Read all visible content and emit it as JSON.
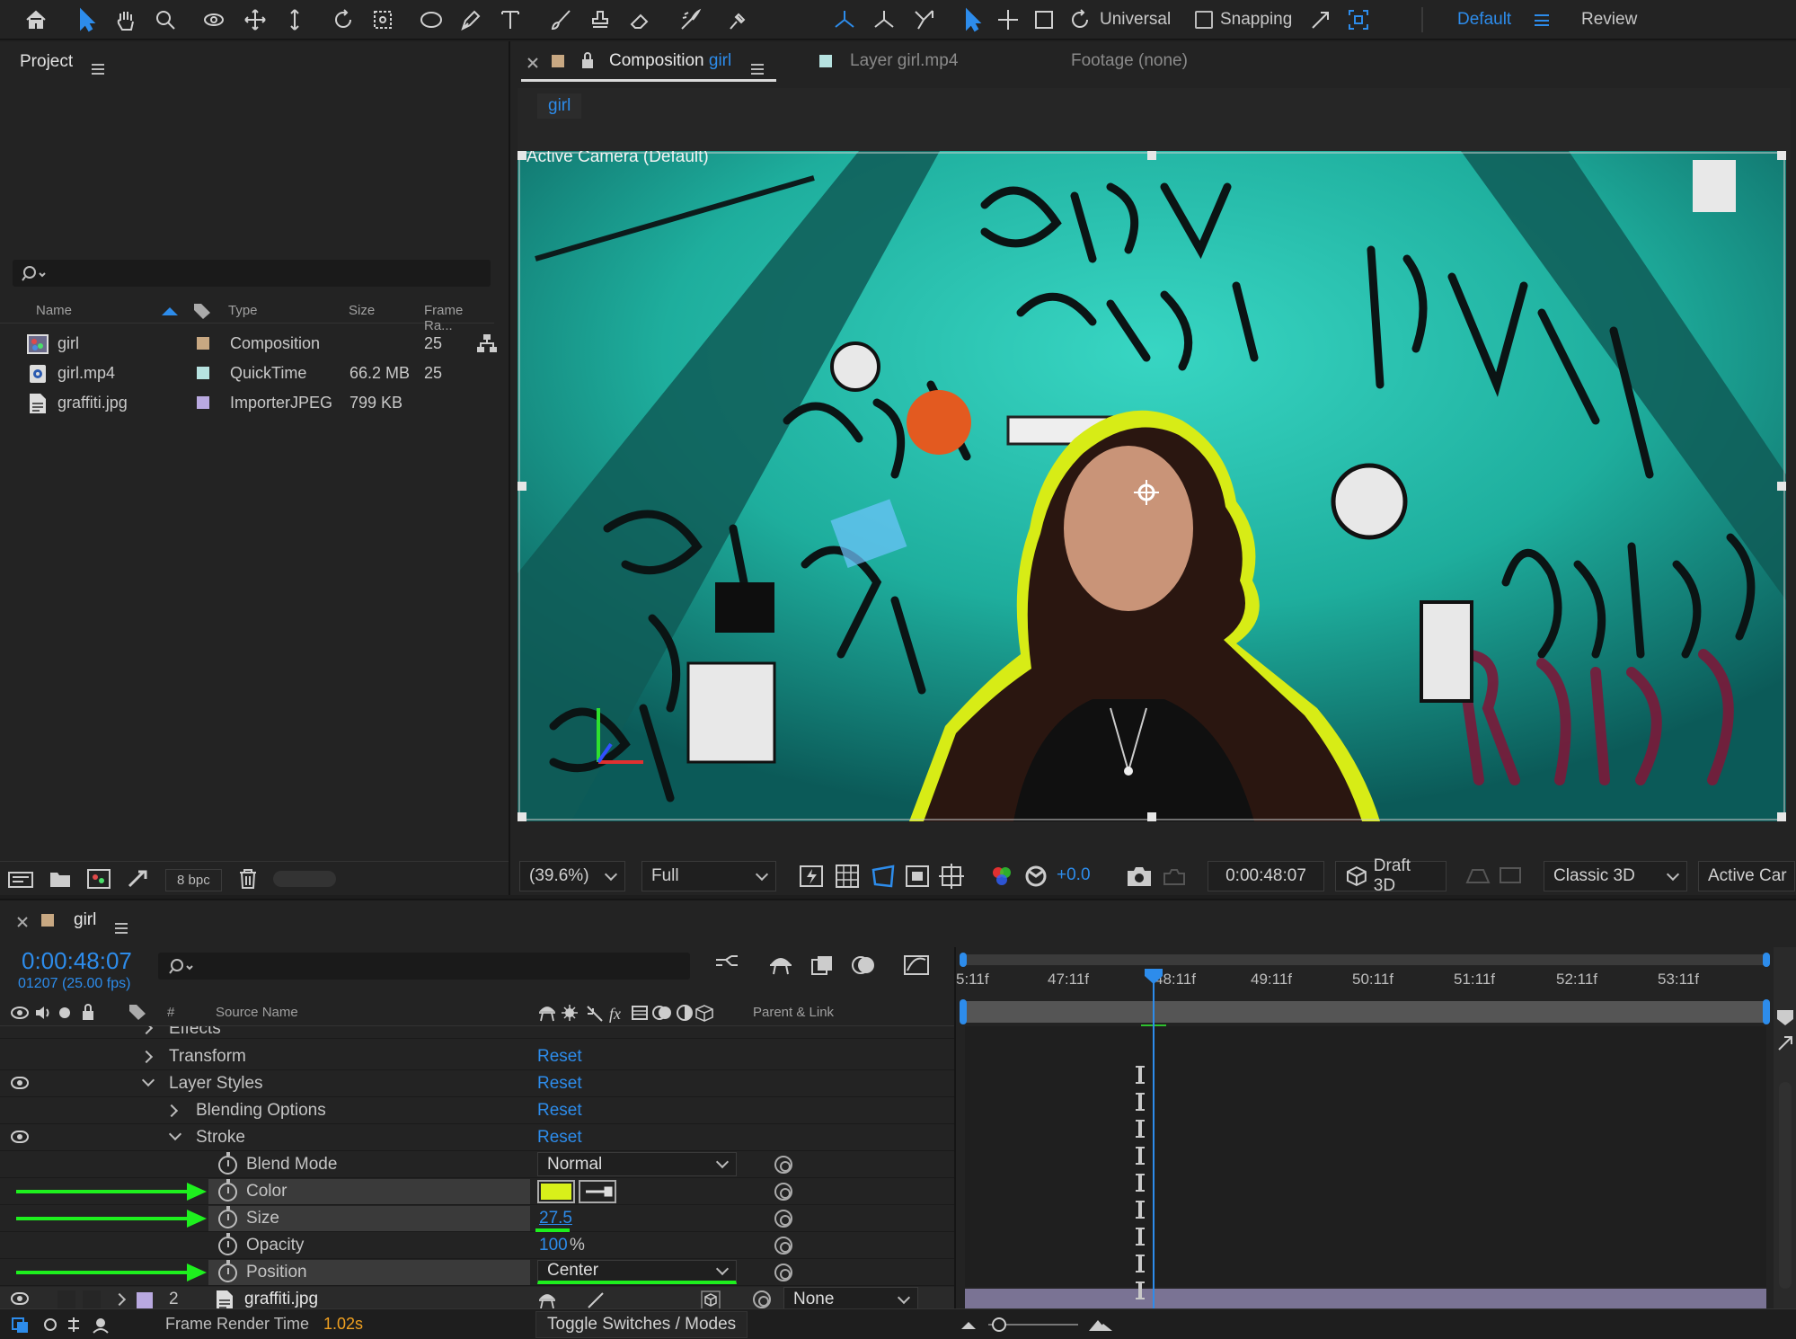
{
  "toolbar": {
    "universal_label": "Universal",
    "snapping_label": "Snapping",
    "workspace_default": "Default",
    "workspace_review": "Review"
  },
  "project": {
    "title": "Project",
    "columns": {
      "name": "Name",
      "type": "Type",
      "size": "Size",
      "frame_rate": "Frame Ra..."
    },
    "items": [
      {
        "name": "girl",
        "type": "Composition",
        "size": "",
        "fps": "25",
        "label_color": "#c8a882",
        "icon": "composition-icon"
      },
      {
        "name": "girl.mp4",
        "type": "QuickTime",
        "size": "66.2 MB",
        "fps": "25",
        "label_color": "#b6e2e0",
        "icon": "video-file-icon"
      },
      {
        "name": "graffiti.jpg",
        "type": "ImporterJPEG",
        "size": "799 KB",
        "fps": "",
        "label_color": "#b9a9e0",
        "icon": "image-file-icon"
      }
    ],
    "bpc": "8 bpc"
  },
  "viewer": {
    "tab_composition_prefix": "Composition",
    "tab_composition_name": "girl",
    "tab_layer": "Layer girl.mp4",
    "tab_footage": "Footage (none)",
    "comp_chip": "girl",
    "camera_label": "Active Camera (Default)",
    "zoom": "(39.6%)",
    "resolution": "Full",
    "exposure": "+0.0",
    "timecode": "0:00:48:07",
    "renderer": "Draft 3D",
    "renderer_mode": "Classic 3D",
    "camera_view": "Active Car"
  },
  "timeline": {
    "comp_name": "girl",
    "timecode": "0:00:48:07",
    "frame_info": "01207 (25.00 fps)",
    "col_number": "#",
    "col_source": "Source Name",
    "col_parent": "Parent & Link",
    "ruler": [
      "5:11f",
      "47:11f",
      "48:11f",
      "49:11f",
      "50:11f",
      "51:11f",
      "52:11f",
      "53:11f"
    ],
    "rows": {
      "effects": "Effects",
      "transform": "Transform",
      "layer_styles": "Layer Styles",
      "blending_options": "Blending Options",
      "stroke": "Stroke",
      "blend_mode": "Blend Mode",
      "color": "Color",
      "size": "Size",
      "opacity": "Opacity",
      "position": "Position"
    },
    "reset_label": "Reset",
    "blend_mode_value": "Normal",
    "size_value": "27.5",
    "opacity_value": "100",
    "opacity_unit": "%",
    "position_value": "Center",
    "stroke_color": "#d8f01a",
    "layer2": {
      "number": "2",
      "name": "graffiti.jpg",
      "parent": "None",
      "label_color": "#b9a9e0"
    },
    "status_label": "Frame Render Time",
    "status_value": "1.02s",
    "toggle_label": "Toggle Switches / Modes"
  }
}
